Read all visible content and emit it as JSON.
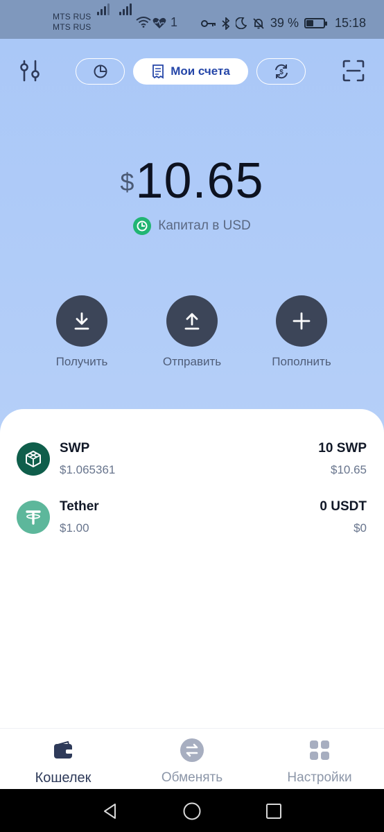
{
  "status_bar": {
    "carrier_1": "MTS RUS",
    "carrier_2": "MTS RUS",
    "battery_percent": "39 %",
    "battery_level": 0.39,
    "time": "15:18",
    "indicator": "1"
  },
  "top_bar": {
    "active_tab_label": "Мои счета"
  },
  "balance": {
    "currency_symbol": "$",
    "amount": "10.65",
    "caption": "Капитал в USD"
  },
  "actions": [
    {
      "label": "Получить",
      "icon": "download-icon"
    },
    {
      "label": "Отправить",
      "icon": "upload-icon"
    },
    {
      "label": "Пополнить",
      "icon": "plus-icon"
    }
  ],
  "assets": [
    {
      "name": "SWP",
      "price": "$1.065361",
      "balance": "10 SWP",
      "fiat": "$10.65",
      "color": "#0f5e4b"
    },
    {
      "name": "Tether",
      "price": "$1.00",
      "balance": "0 USDT",
      "fiat": "$0",
      "color": "#5db79b"
    }
  ],
  "bottom_nav": [
    {
      "label": "Кошелек",
      "active": true
    },
    {
      "label": "Обменять",
      "active": false
    },
    {
      "label": "Настройки",
      "active": false
    }
  ],
  "colors": {
    "accent": "#2546a8",
    "action_button": "#3c4558",
    "capital_green": "#21b573"
  }
}
